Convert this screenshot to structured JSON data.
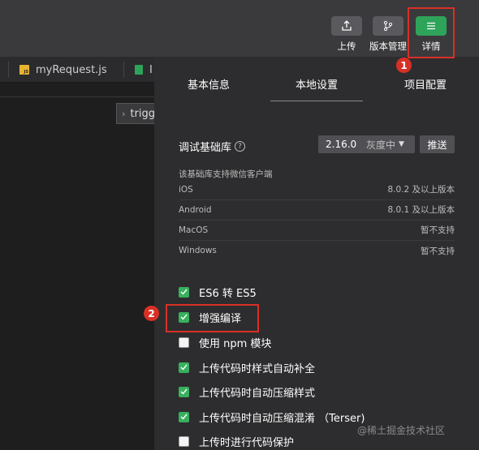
{
  "toolbar": {
    "upload_label": "上传",
    "version_label": "版本管理",
    "details_label": "详情"
  },
  "tabs": {
    "file1": "myRequest.js",
    "file2": "I"
  },
  "editor": {
    "breadcrumb": "trigg"
  },
  "panel": {
    "tabs": [
      "基本信息",
      "本地设置",
      "项目配置"
    ],
    "active_tab": "本地设置",
    "lib": {
      "label": "调试基础库",
      "help": "?",
      "version": "2.16.0",
      "channel": "灰度中",
      "push_label": "推送"
    },
    "support_heading": "该基础库支持微信客户端",
    "support": [
      {
        "os": "iOS",
        "req": "8.0.2 及以上版本"
      },
      {
        "os": "Android",
        "req": "8.0.1 及以上版本"
      },
      {
        "os": "MacOS",
        "req": "暂不支持"
      },
      {
        "os": "Windows",
        "req": "暂不支持"
      }
    ],
    "options": [
      {
        "label": "ES6 转 ES5",
        "checked": true
      },
      {
        "label": "增强编译",
        "checked": true
      },
      {
        "label": "使用 npm 模块",
        "checked": false
      },
      {
        "label": "上传代码时样式自动补全",
        "checked": true
      },
      {
        "label": "上传代码时自动压缩样式",
        "checked": true
      },
      {
        "label": "上传代码时自动压缩混淆 （Terser)",
        "checked": true
      },
      {
        "label": "上传时进行代码保护",
        "checked": false
      }
    ]
  },
  "annotations": {
    "badge1": "1",
    "badge2": "2"
  },
  "watermark": "@稀土掘金技术社区",
  "colors": {
    "accent_green": "#2ea35a",
    "annotation_red": "#d93025"
  }
}
